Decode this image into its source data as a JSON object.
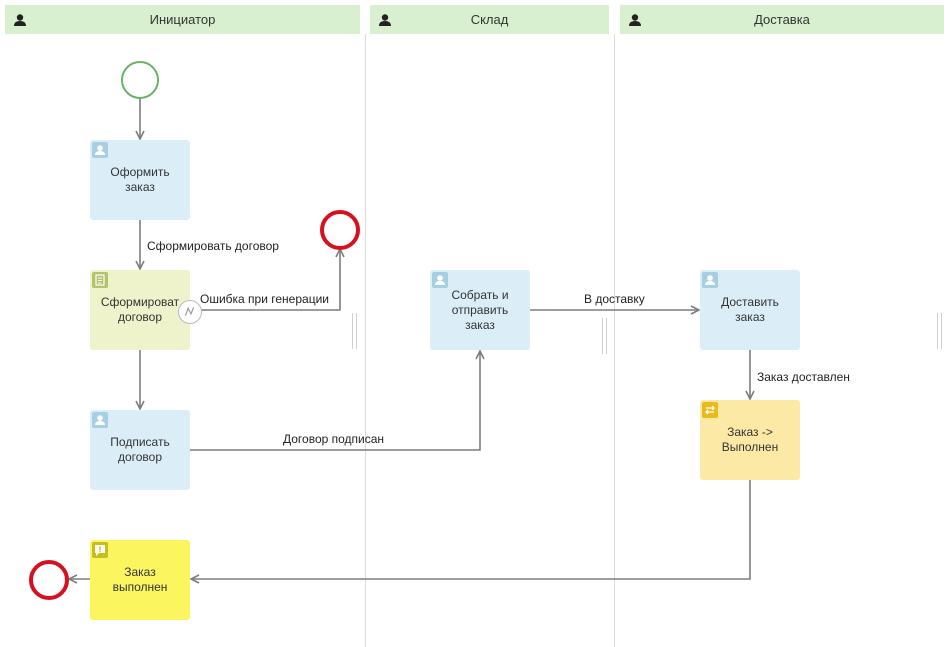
{
  "lanes": [
    {
      "label": "Инициатор",
      "icon": "user-icon"
    },
    {
      "label": "Склад",
      "icon": "user-icon"
    },
    {
      "label": "Доставка",
      "icon": "user-icon"
    }
  ],
  "nodes": {
    "make_order": {
      "label": "Оформить\nзаказ",
      "icon": "user-icon"
    },
    "generate_contract": {
      "label": "Сформироват\nдоговор",
      "icon": "document-icon"
    },
    "sign_contract": {
      "label": "Подписать\nдоговор",
      "icon": "user-icon"
    },
    "order_done_notify": {
      "label": "Заказ\nвыполнен",
      "icon": "notification-icon"
    },
    "assemble_ship": {
      "label": "Собрать и\nотправить\nзаказ",
      "icon": "user-icon"
    },
    "deliver_order": {
      "label": "Доставить\nзаказ",
      "icon": "user-icon"
    },
    "status_done": {
      "label": "Заказ ->\nВыполнен",
      "icon": "status-change-icon"
    }
  },
  "edges": {
    "form_contract": "Сформировать договор",
    "gen_error": "Ошибка при генерации",
    "contract_signed": "Договор подписан",
    "to_delivery": "В доставку",
    "delivered": "Заказ доставлен"
  },
  "colors": {
    "lane_header": "#d9f0d0",
    "user_task": "#dbeef8",
    "doc_task": "#eef3cc",
    "status_task": "#fde9a6",
    "notify_task": "#fbf55f",
    "start_event": "#69b06a",
    "end_event": "#d6101f",
    "edge": "#7d7d7d"
  }
}
